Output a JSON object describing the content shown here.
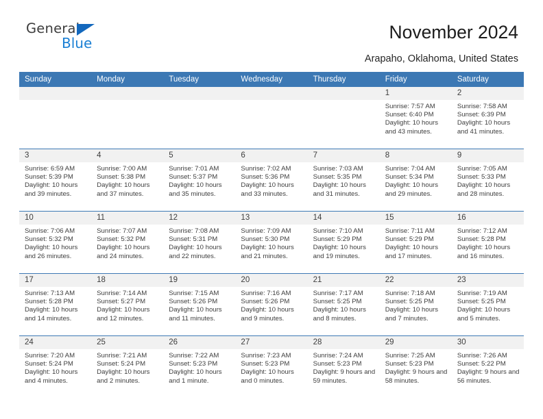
{
  "brand": {
    "name_part1": "General",
    "name_part2": "Blue"
  },
  "header": {
    "title": "November 2024",
    "location": "Arapaho, Oklahoma, United States"
  },
  "colors": {
    "header_blue": "#3c78b4",
    "logo_blue": "#1a7fd4",
    "daynum_bg": "#f1f1f1",
    "text": "#3d3d3d"
  },
  "calendar": {
    "weekdays": [
      "Sunday",
      "Monday",
      "Tuesday",
      "Wednesday",
      "Thursday",
      "Friday",
      "Saturday"
    ],
    "leading_blanks": 5,
    "days": [
      {
        "n": "1",
        "sunrise": "Sunrise: 7:57 AM",
        "sunset": "Sunset: 6:40 PM",
        "daylight": "Daylight: 10 hours and 43 minutes."
      },
      {
        "n": "2",
        "sunrise": "Sunrise: 7:58 AM",
        "sunset": "Sunset: 6:39 PM",
        "daylight": "Daylight: 10 hours and 41 minutes."
      },
      {
        "n": "3",
        "sunrise": "Sunrise: 6:59 AM",
        "sunset": "Sunset: 5:39 PM",
        "daylight": "Daylight: 10 hours and 39 minutes."
      },
      {
        "n": "4",
        "sunrise": "Sunrise: 7:00 AM",
        "sunset": "Sunset: 5:38 PM",
        "daylight": "Daylight: 10 hours and 37 minutes."
      },
      {
        "n": "5",
        "sunrise": "Sunrise: 7:01 AM",
        "sunset": "Sunset: 5:37 PM",
        "daylight": "Daylight: 10 hours and 35 minutes."
      },
      {
        "n": "6",
        "sunrise": "Sunrise: 7:02 AM",
        "sunset": "Sunset: 5:36 PM",
        "daylight": "Daylight: 10 hours and 33 minutes."
      },
      {
        "n": "7",
        "sunrise": "Sunrise: 7:03 AM",
        "sunset": "Sunset: 5:35 PM",
        "daylight": "Daylight: 10 hours and 31 minutes."
      },
      {
        "n": "8",
        "sunrise": "Sunrise: 7:04 AM",
        "sunset": "Sunset: 5:34 PM",
        "daylight": "Daylight: 10 hours and 29 minutes."
      },
      {
        "n": "9",
        "sunrise": "Sunrise: 7:05 AM",
        "sunset": "Sunset: 5:33 PM",
        "daylight": "Daylight: 10 hours and 28 minutes."
      },
      {
        "n": "10",
        "sunrise": "Sunrise: 7:06 AM",
        "sunset": "Sunset: 5:32 PM",
        "daylight": "Daylight: 10 hours and 26 minutes."
      },
      {
        "n": "11",
        "sunrise": "Sunrise: 7:07 AM",
        "sunset": "Sunset: 5:32 PM",
        "daylight": "Daylight: 10 hours and 24 minutes."
      },
      {
        "n": "12",
        "sunrise": "Sunrise: 7:08 AM",
        "sunset": "Sunset: 5:31 PM",
        "daylight": "Daylight: 10 hours and 22 minutes."
      },
      {
        "n": "13",
        "sunrise": "Sunrise: 7:09 AM",
        "sunset": "Sunset: 5:30 PM",
        "daylight": "Daylight: 10 hours and 21 minutes."
      },
      {
        "n": "14",
        "sunrise": "Sunrise: 7:10 AM",
        "sunset": "Sunset: 5:29 PM",
        "daylight": "Daylight: 10 hours and 19 minutes."
      },
      {
        "n": "15",
        "sunrise": "Sunrise: 7:11 AM",
        "sunset": "Sunset: 5:29 PM",
        "daylight": "Daylight: 10 hours and 17 minutes."
      },
      {
        "n": "16",
        "sunrise": "Sunrise: 7:12 AM",
        "sunset": "Sunset: 5:28 PM",
        "daylight": "Daylight: 10 hours and 16 minutes."
      },
      {
        "n": "17",
        "sunrise": "Sunrise: 7:13 AM",
        "sunset": "Sunset: 5:28 PM",
        "daylight": "Daylight: 10 hours and 14 minutes."
      },
      {
        "n": "18",
        "sunrise": "Sunrise: 7:14 AM",
        "sunset": "Sunset: 5:27 PM",
        "daylight": "Daylight: 10 hours and 12 minutes."
      },
      {
        "n": "19",
        "sunrise": "Sunrise: 7:15 AM",
        "sunset": "Sunset: 5:26 PM",
        "daylight": "Daylight: 10 hours and 11 minutes."
      },
      {
        "n": "20",
        "sunrise": "Sunrise: 7:16 AM",
        "sunset": "Sunset: 5:26 PM",
        "daylight": "Daylight: 10 hours and 9 minutes."
      },
      {
        "n": "21",
        "sunrise": "Sunrise: 7:17 AM",
        "sunset": "Sunset: 5:25 PM",
        "daylight": "Daylight: 10 hours and 8 minutes."
      },
      {
        "n": "22",
        "sunrise": "Sunrise: 7:18 AM",
        "sunset": "Sunset: 5:25 PM",
        "daylight": "Daylight: 10 hours and 7 minutes."
      },
      {
        "n": "23",
        "sunrise": "Sunrise: 7:19 AM",
        "sunset": "Sunset: 5:25 PM",
        "daylight": "Daylight: 10 hours and 5 minutes."
      },
      {
        "n": "24",
        "sunrise": "Sunrise: 7:20 AM",
        "sunset": "Sunset: 5:24 PM",
        "daylight": "Daylight: 10 hours and 4 minutes."
      },
      {
        "n": "25",
        "sunrise": "Sunrise: 7:21 AM",
        "sunset": "Sunset: 5:24 PM",
        "daylight": "Daylight: 10 hours and 2 minutes."
      },
      {
        "n": "26",
        "sunrise": "Sunrise: 7:22 AM",
        "sunset": "Sunset: 5:23 PM",
        "daylight": "Daylight: 10 hours and 1 minute."
      },
      {
        "n": "27",
        "sunrise": "Sunrise: 7:23 AM",
        "sunset": "Sunset: 5:23 PM",
        "daylight": "Daylight: 10 hours and 0 minutes."
      },
      {
        "n": "28",
        "sunrise": "Sunrise: 7:24 AM",
        "sunset": "Sunset: 5:23 PM",
        "daylight": "Daylight: 9 hours and 59 minutes."
      },
      {
        "n": "29",
        "sunrise": "Sunrise: 7:25 AM",
        "sunset": "Sunset: 5:23 PM",
        "daylight": "Daylight: 9 hours and 58 minutes."
      },
      {
        "n": "30",
        "sunrise": "Sunrise: 7:26 AM",
        "sunset": "Sunset: 5:22 PM",
        "daylight": "Daylight: 9 hours and 56 minutes."
      }
    ]
  }
}
